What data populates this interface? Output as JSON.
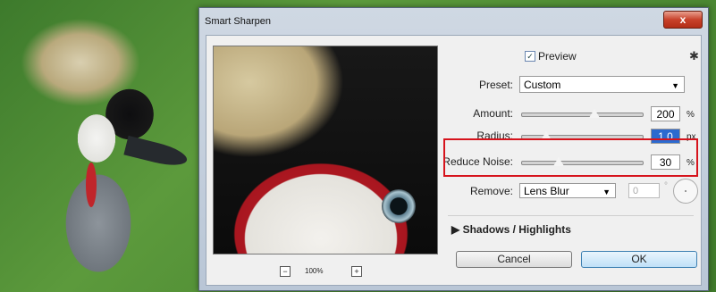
{
  "dialog": {
    "title": "Smart Sharpen",
    "close_glyph": "x",
    "preview_checked": "✓",
    "preview_label": "Preview",
    "gear_icon": "gear-icon",
    "preset": {
      "label": "Preset:",
      "value": "Custom"
    },
    "amount": {
      "label": "Amount:",
      "value": "200",
      "unit": "%",
      "level": 0.6
    },
    "radius": {
      "label": "Radius:",
      "value": "1.0",
      "unit": "px",
      "level": 0.2
    },
    "reduce_noise": {
      "label": "Reduce Noise:",
      "value": "30",
      "unit": "%",
      "level": 0.3
    },
    "remove": {
      "label": "Remove:",
      "value": "Lens Blur",
      "angle_value": "0",
      "angle_unit": "°"
    },
    "shadows_highlights": "Shadows / Highlights",
    "zoom": {
      "minus": "−",
      "plus": "+",
      "level": "100%"
    },
    "cancel_label": "Cancel",
    "ok_label": "OK"
  },
  "colors": {
    "highlight_box": "#d6131c",
    "ok_button": "#bfe0f7",
    "selected_field": "#2b6ad0"
  }
}
